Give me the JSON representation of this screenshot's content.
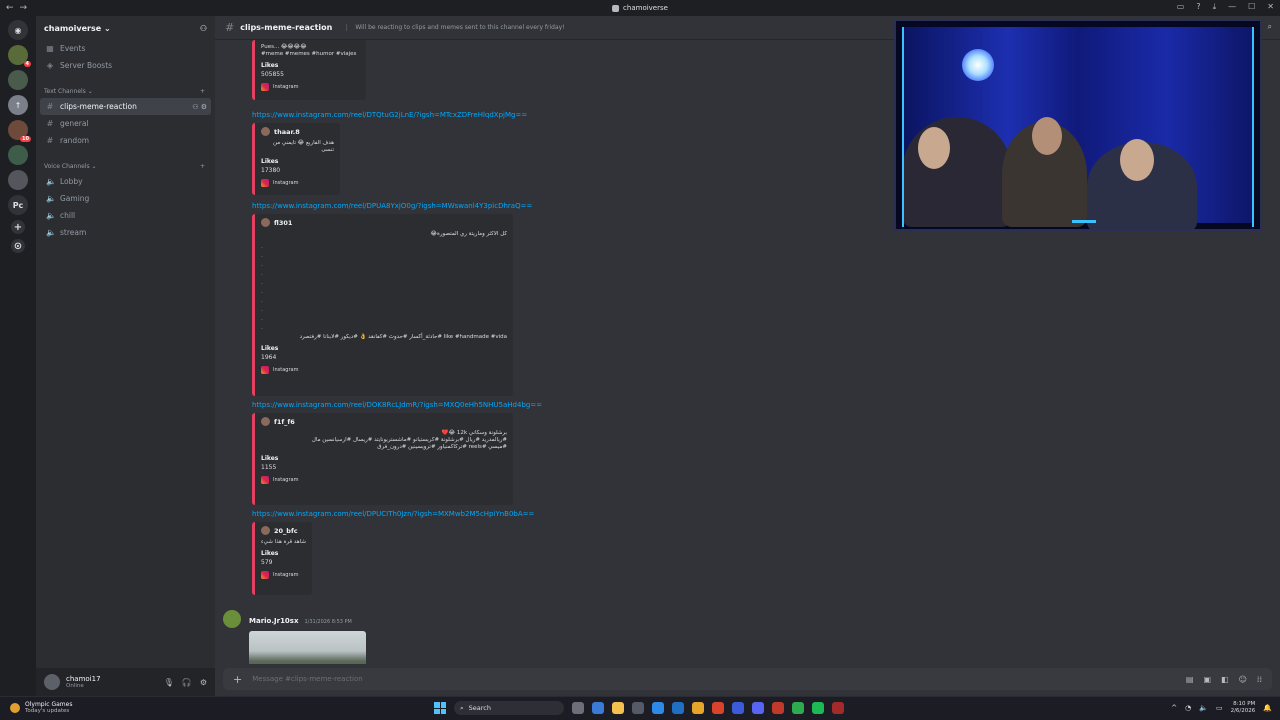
{
  "window": {
    "title": "chamoiverse"
  },
  "guild": {
    "name": "chamoiverse"
  },
  "nav": {
    "events": "Events",
    "boosts": "Server Boosts"
  },
  "text_category": "Text Channels",
  "text_channels": [
    "clips-meme-reaction",
    "general",
    "random"
  ],
  "voice_category": "Voice Channels",
  "voice_channels": [
    "Lobby",
    "Gaming",
    "chill",
    "stream"
  ],
  "user": {
    "name": "chamoi17",
    "status": "Online"
  },
  "servers": [
    {
      "label": "",
      "color": "#5a6b3a",
      "badge": "4"
    },
    {
      "label": "",
      "color": "#4a5b4c",
      "badge": ""
    },
    {
      "label": "↑",
      "color": "#7a7f8a",
      "badge": ""
    },
    {
      "label": "",
      "color": "#6d4a3a",
      "badge": "10"
    },
    {
      "label": "",
      "color": "#3e5c4a",
      "badge": ""
    },
    {
      "label": "",
      "color": "#55565d",
      "badge": ""
    },
    {
      "label": "Pc",
      "color": "#2b2d31",
      "badge": ""
    }
  ],
  "channel": {
    "name": "clips-meme-reaction",
    "topic": "Will be reacting to clips and memes sent to this channel every friday!"
  },
  "embeds": [
    {
      "author": "",
      "desc": "Pues... 😂😂😂😂\n#meme #memes #humor #viajes",
      "likes_label": "Likes",
      "likes": "505855",
      "footer": "Instagram"
    },
    {
      "link": "https://www.instagram.com/reel/DTQtuG2jLnE/?igsh=MTcxZDFreHlqdXpjMg==",
      "author": "thaar.8",
      "desc": "هدف الفاريع 😂 تايمني من تنسى",
      "likes_label": "Likes",
      "likes": "17380",
      "footer": "Instagram"
    },
    {
      "link": "https://www.instagram.com/reel/DPUA8YxjO0g/?igsh=MWswanl4Y3picDhraQ==",
      "author": "fl301",
      "desc_top": "كل الاكثر وماريتة ري المتصورة😂",
      "desc": "like #handmade #vida #حادثة_أكسار #حدوث #كفانقد 👌 #ديكور #لابنانا #رفتصرد",
      "likes_label": "Likes",
      "likes": "1964",
      "footer": "Instagram"
    },
    {
      "link": "https://www.instagram.com/reel/DOK8RcLJdmR/?igsh=MXQ0eHh5NHU5aHd4bg==",
      "author": "f1f_f6",
      "desc": "برشلونة وسكاني 12k 😂❤️\n#ريالمدريد #ريال #برشلونة #كريستيانو #ماشستريونايتد #ريسال #ارسيانسين مال\n#ميسي #reels #تركاكمنياور #ترويسينين #درون_فرق",
      "likes_label": "Likes",
      "likes": "1155",
      "footer": "Instagram"
    },
    {
      "link": "https://www.instagram.com/reel/DPUCITh0Jzn/?igsh=MXMwb2M5cHpiYnB0bA==",
      "author": "20_bfc",
      "desc": "شاهد قرة هذا شيء",
      "likes_label": "Likes",
      "likes": "579",
      "footer": "Instagram"
    }
  ],
  "message": {
    "user": "Mario.Jr10sx",
    "time": "1/31/2026 8:53 PM"
  },
  "composer": {
    "placeholder": "Message #clips-meme-reaction"
  },
  "taskbar": {
    "news_title": "Olympic Games",
    "news_sub": "Today's updates",
    "search": "Search",
    "time": "8:10 PM",
    "date": "2/6/2026"
  }
}
